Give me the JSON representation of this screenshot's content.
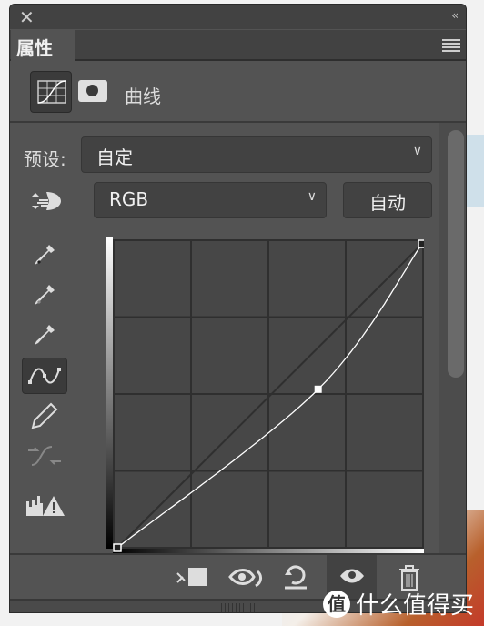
{
  "panel": {
    "tab_label": "属性",
    "header_title": "曲线",
    "preset_label": "预设:",
    "preset_value": "自定",
    "channel_value": "RGB",
    "auto_button": "自动"
  },
  "curve": {
    "input_range": [
      0,
      255
    ],
    "points": [
      [
        0,
        0
      ],
      [
        168,
        133
      ],
      [
        255,
        255
      ]
    ]
  },
  "icons": {
    "close": "close-icon",
    "collapse": "double-chevron-left-icon",
    "menu": "hamburger-menu-icon",
    "tools": [
      "on-image-adjust-icon",
      "black-point-eyedropper-icon",
      "gray-point-eyedropper-icon",
      "white-point-eyedropper-icon",
      "curve-points-icon",
      "pencil-icon",
      "smooth-icon",
      "clipping-warning-icon"
    ],
    "bottom": [
      "clip-to-layer-icon",
      "view-previous-icon",
      "reset-icon",
      "visibility-eye-icon",
      "trash-icon"
    ]
  },
  "watermark": {
    "logo": "值",
    "text": "什么值得买"
  },
  "colors": {
    "panel": "#535353",
    "dark": "#424242",
    "curve": "#ffffff",
    "grid": "#2f2f2f"
  }
}
